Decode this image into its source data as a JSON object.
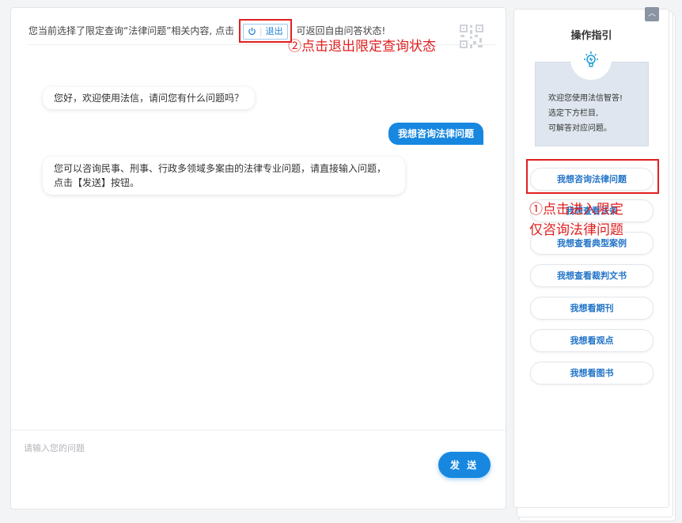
{
  "notice": {
    "prefix": "您当前选择了限定查询“法律问题”相关内容, 点击",
    "exit_label": "退出",
    "suffix": "可返回自由问答状态!"
  },
  "annotations": {
    "exit_hint": "②点击退出限定查询状态",
    "select_hint": "①点击进入限定\n仅咨询法律问题"
  },
  "chat": {
    "messages": [
      {
        "side": "left",
        "text": "您好，欢迎使用法信，请问您有什么问题吗？"
      },
      {
        "side": "right",
        "text": "我想咨询法律问题"
      },
      {
        "side": "left",
        "text": "您可以咨询民事、刑事、行政多领域多案由的法律专业问题，请直接输入问题，点击【发送】按钮。"
      }
    ],
    "input_placeholder": "请输入您的问题",
    "send_label": "发 送"
  },
  "guide": {
    "title": "操作指引",
    "collapse_icon": "chevron-up-icon",
    "info_lines": [
      "欢迎您使用法信智答!",
      "选定下方栏目,",
      "可解答对应问题。"
    ],
    "items": [
      "我想咨询法律问题",
      "我想查看法条",
      "我想查看典型案例",
      "我想查看裁判文书",
      "我想看期刊",
      "我想看观点",
      "我想看图书"
    ]
  },
  "colors": {
    "accent": "#1787e0",
    "annotation": "#e02020",
    "link": "#2274c8"
  }
}
